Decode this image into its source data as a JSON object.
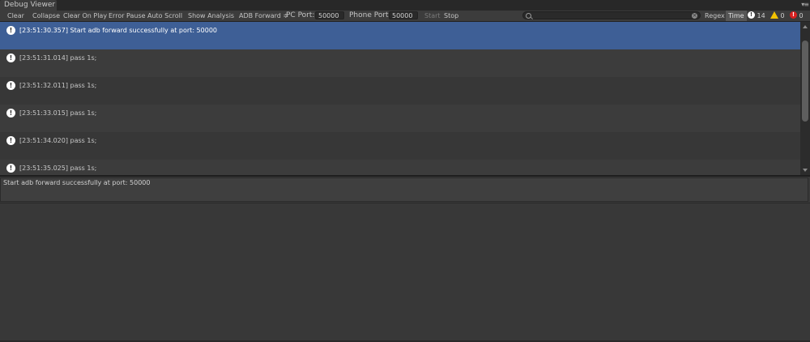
{
  "window": {
    "tab_title": "Debug Viewer",
    "tab_menu_glyph": "▾≡"
  },
  "toolbar": {
    "clear": "Clear",
    "collapse": "Collapse",
    "clear_on_play": "Clear On Play",
    "error_pause": "Error Pause",
    "auto_scroll": "Auto Scroll",
    "show_analysis": "Show Analysis",
    "adb_forward": "ADB Forward",
    "adb_forward_arrow": "≑",
    "pc_port_label": "PC Port:",
    "pc_port_value": "50000",
    "phone_port_label": "Phone Port:",
    "phone_port_value": "50000",
    "start": "Start",
    "stop": "Stop",
    "search_value": "",
    "regex": "Regex",
    "time": "Time",
    "info_count": "14",
    "warning_count": "0",
    "error_count": "0"
  },
  "logs": [
    {
      "text": "[23:51:30.357] Start adb forward successfully at port: 50000",
      "selected": true
    },
    {
      "text": "[23:51:31.014] pass 1s;",
      "selected": false
    },
    {
      "text": "[23:51:32.011] pass 1s;",
      "selected": false
    },
    {
      "text": "[23:51:33.015] pass 1s;",
      "selected": false
    },
    {
      "text": "[23:51:34.020] pass 1s;",
      "selected": false
    },
    {
      "text": "[23:51:35.025] pass 1s;",
      "selected": false
    }
  ],
  "detail": {
    "message": "Start adb forward successfully at port: 50000"
  },
  "colors": {
    "selection": "#3e5f96",
    "warning": "#f2c200",
    "error": "#d92020"
  },
  "icons": {
    "info": "info-icon",
    "warning": "warning-icon",
    "error": "error-icon"
  }
}
